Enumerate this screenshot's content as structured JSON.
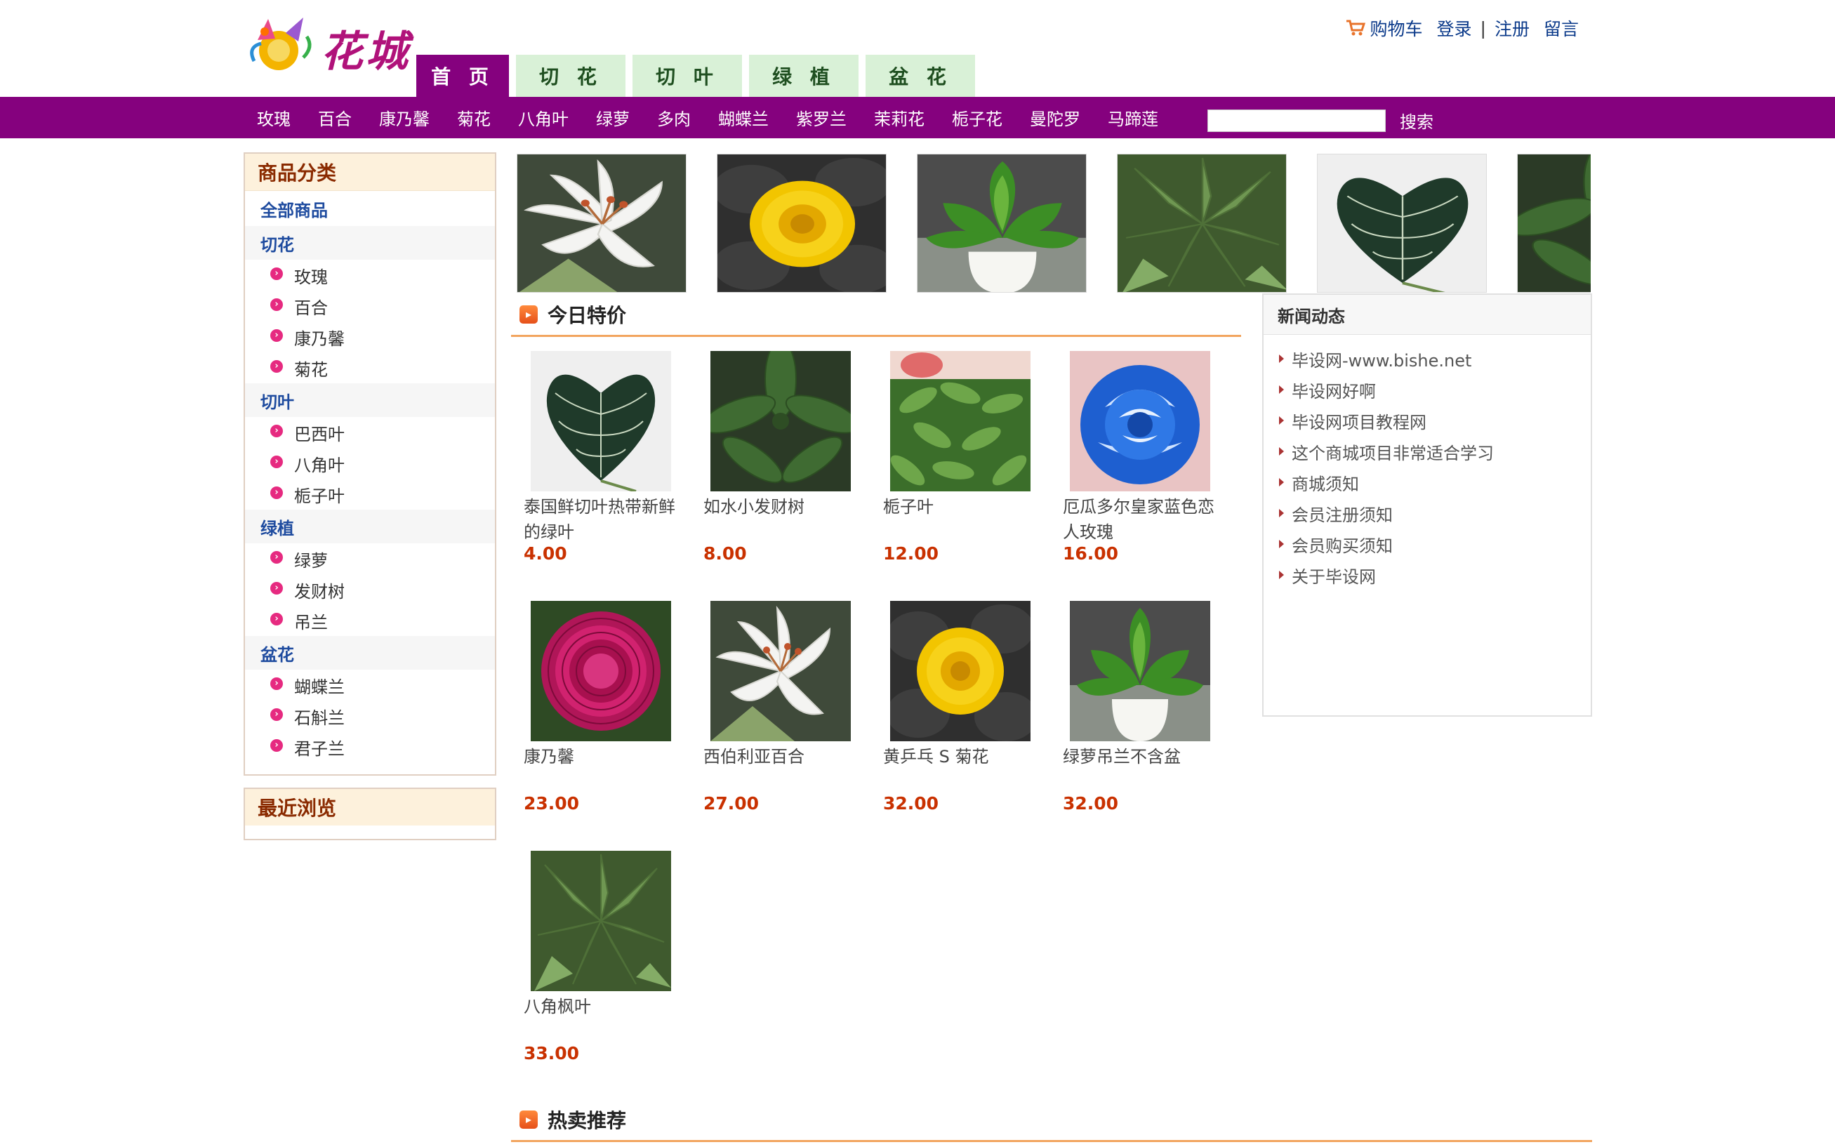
{
  "site": {
    "logo_text": "花城"
  },
  "toplinks": {
    "cart": "购物车",
    "login": "登录",
    "separator": "|",
    "register": "注册",
    "message": "留言"
  },
  "tabs": [
    "首 页",
    "切 花",
    "切 叶",
    "绿 植",
    "盆 花"
  ],
  "nav_categories": [
    "玫瑰",
    "百合",
    "康乃馨",
    "菊花",
    "八角叶",
    "绿萝",
    "多肉",
    "蝴蝶兰",
    "紫罗兰",
    "茉莉花",
    "栀子花",
    "曼陀罗",
    "马蹄莲"
  ],
  "search": {
    "value": "",
    "button": "搜索"
  },
  "sidebar": {
    "title": "商品分类",
    "all": "全部商品",
    "groups": [
      {
        "title": "切花",
        "items": [
          "玫瑰",
          "百合",
          "康乃馨",
          "菊花"
        ]
      },
      {
        "title": "切叶",
        "items": [
          "巴西叶",
          "八角叶",
          "栀子叶"
        ]
      },
      {
        "title": "绿植",
        "items": [
          "绿萝",
          "发财树",
          "吊兰"
        ]
      },
      {
        "title": "盆花",
        "items": [
          "蝴蝶兰",
          "石斛兰",
          "君子兰"
        ]
      }
    ],
    "recent_title": "最近浏览"
  },
  "sections": {
    "special": "今日特价",
    "hot": "热卖推荐"
  },
  "products": [
    {
      "name": "泰国鲜切叶热带新鲜的绿叶",
      "price": "4.00",
      "img": "anthurium-leaf"
    },
    {
      "name": "如水小发财树",
      "price": "8.00",
      "img": "schefflera"
    },
    {
      "name": "栀子叶",
      "price": "12.00",
      "img": "gardenia-leaves"
    },
    {
      "name": "厄瓜多尔皇家蓝色恋人玫瑰",
      "price": "16.00",
      "img": "blue-rose"
    },
    {
      "name": "康乃馨",
      "price": "23.00",
      "img": "peony"
    },
    {
      "name": "西伯利亚百合",
      "price": "27.00",
      "img": "lily"
    },
    {
      "name": "黄乒乓 S 菊花",
      "price": "32.00",
      "img": "chrysanthemum"
    },
    {
      "name": "绿萝吊兰不含盆",
      "price": "32.00",
      "img": "pothos"
    },
    {
      "name": "八角枫叶",
      "price": "33.00",
      "img": "fatsia"
    }
  ],
  "news": {
    "title": "新闻动态",
    "items": [
      "毕设网-www.bishe.net",
      "毕设网好啊",
      "毕设网项目教程网",
      "这个商城项目非常适合学习",
      "商城须知",
      "会员注册须知",
      "会员购买须知",
      "关于毕设网"
    ]
  },
  "colors": {
    "brand_purple": "#85017e",
    "tab_green": "#d9f1d7",
    "price": "#c93100",
    "link_blue": "#1e4b9f"
  }
}
